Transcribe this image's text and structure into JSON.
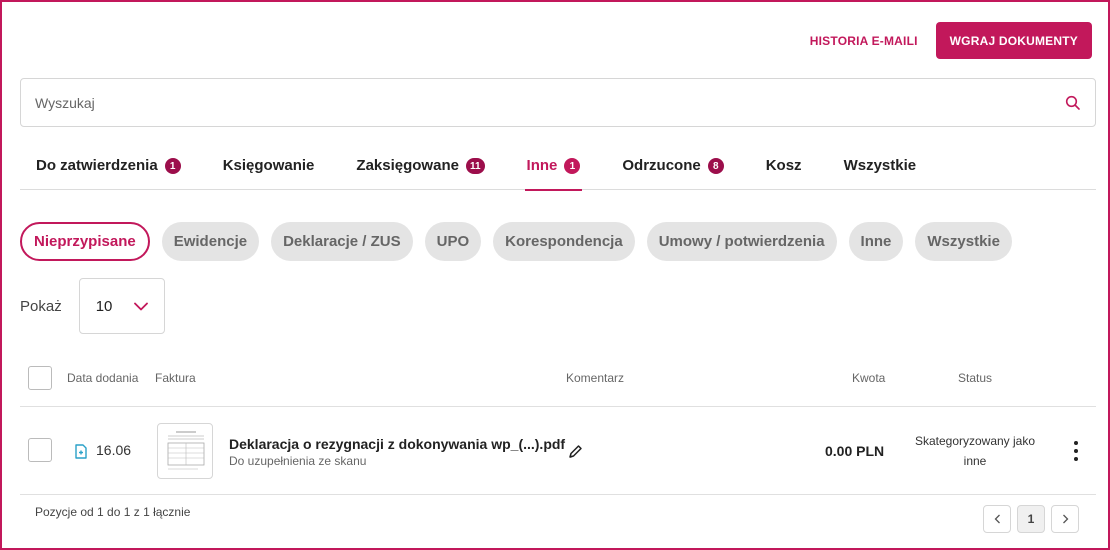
{
  "header": {
    "email_history_label": "HISTORIA E-MAILI",
    "upload_label": "WGRAJ DOKUMENTY"
  },
  "search": {
    "placeholder": "Wyszukaj",
    "value": ""
  },
  "tabs": [
    {
      "label": "Do zatwierdzenia",
      "badge": "1"
    },
    {
      "label": "Księgowanie",
      "badge": ""
    },
    {
      "label": "Zaksięgowane",
      "badge": "11"
    },
    {
      "label": "Inne",
      "badge": "1",
      "active": true
    },
    {
      "label": "Odrzucone",
      "badge": "8"
    },
    {
      "label": "Kosz",
      "badge": ""
    },
    {
      "label": "Wszystkie",
      "badge": ""
    }
  ],
  "chips": [
    "Nieprzypisane",
    "Ewidencje",
    "Deklaracje / ZUS",
    "UPO",
    "Korespondencja",
    "Umowy / potwierdzenia",
    "Inne",
    "Wszystkie"
  ],
  "active_chip": "Nieprzypisane",
  "show": {
    "label": "Pokaż",
    "value": "10"
  },
  "table": {
    "columns": {
      "date": "Data dodania",
      "invoice": "Faktura",
      "comment": "Komentarz",
      "amount": "Kwota",
      "status": "Status"
    },
    "rows": [
      {
        "date": "16.06",
        "name": "Deklaracja o rezygnacji z dokonywania wp_(...).pdf",
        "subtitle": "Do uzupełnienia ze skanu",
        "amount": "0.00 PLN",
        "status": "Skategoryzowany jako inne"
      }
    ]
  },
  "footer": {
    "summary": "Pozycje od 1 do 1 z 1 łącznie",
    "current_page": "1"
  },
  "colors": {
    "accent": "#c2185b",
    "badge": "#9c0e4b",
    "chip_bg": "#e4e4e4"
  },
  "icons": [
    "search-icon",
    "chevron-down-icon",
    "document-icon",
    "pencil-icon",
    "more-vertical-icon",
    "chevron-left-icon",
    "chevron-right-icon"
  ]
}
